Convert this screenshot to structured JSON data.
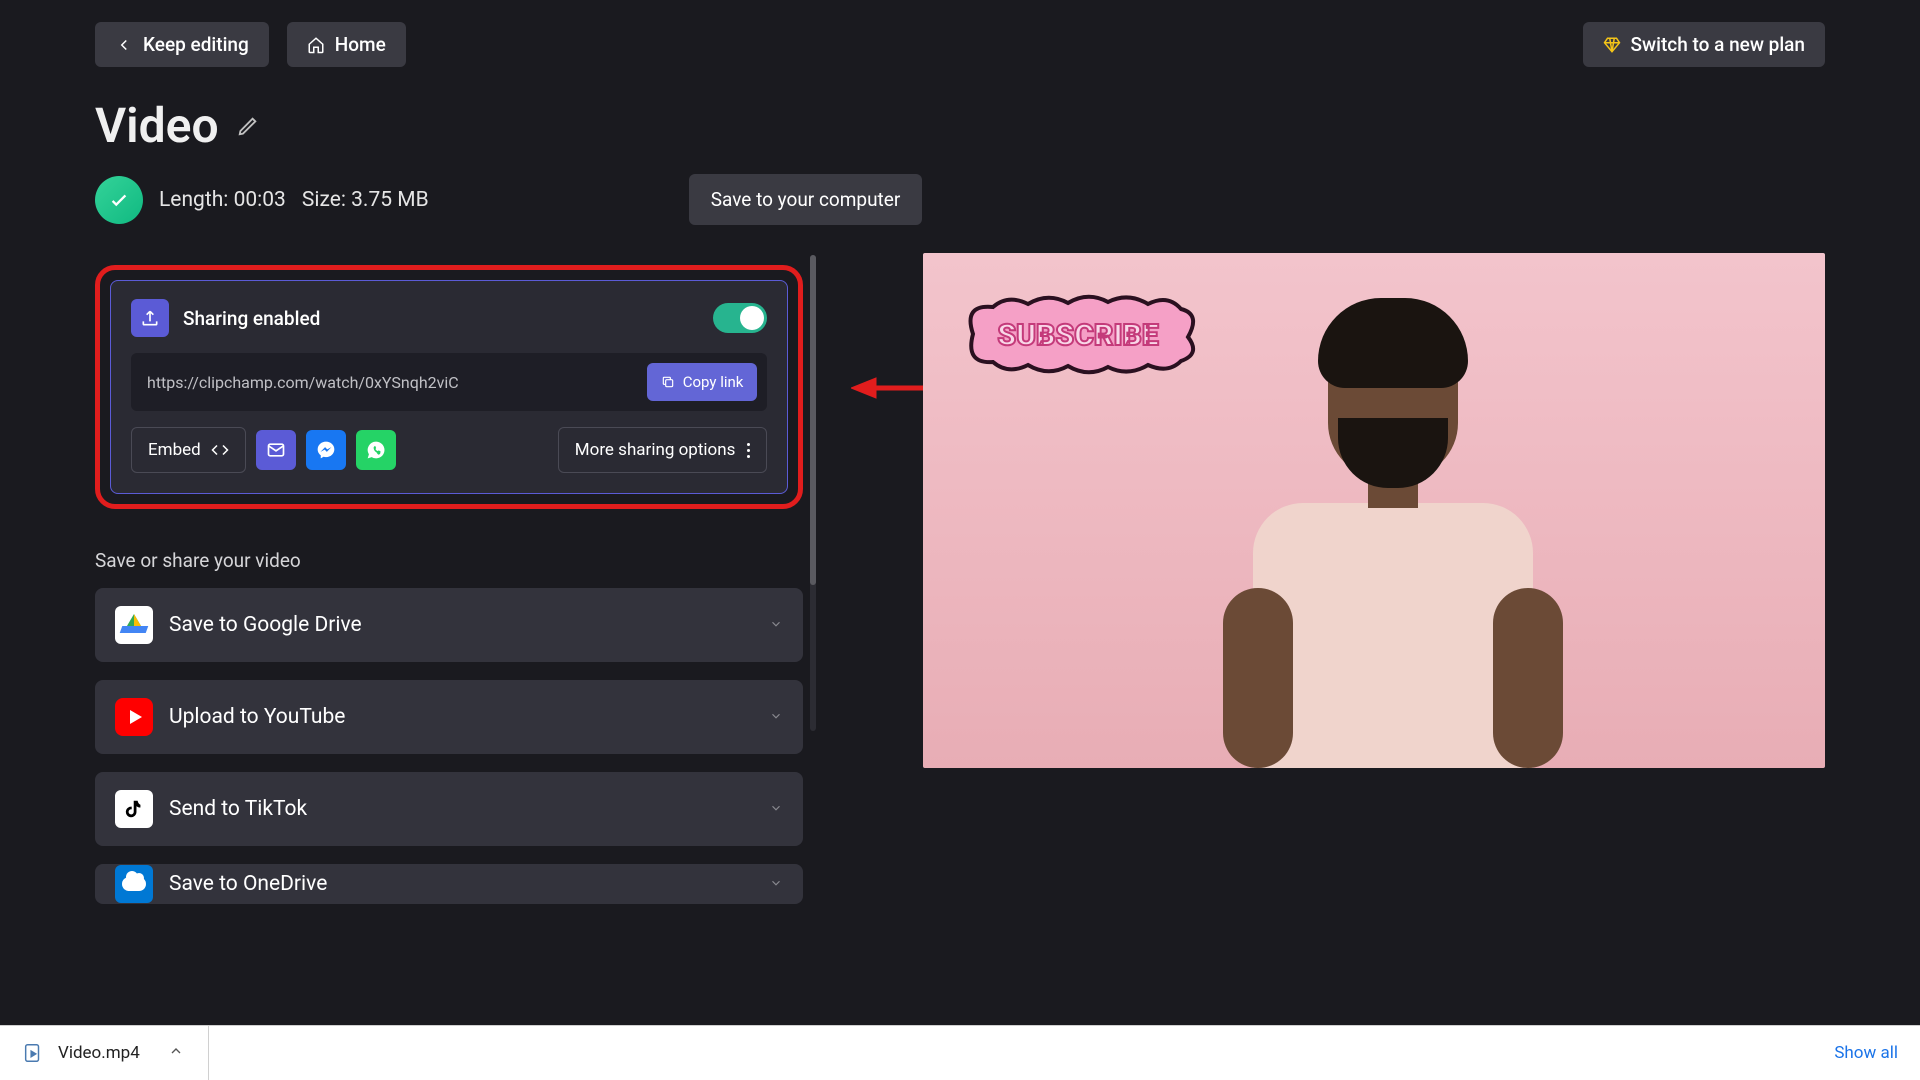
{
  "topbar": {
    "keep_editing": "Keep editing",
    "home": "Home",
    "switch_plan": "Switch to a new plan"
  },
  "title": "Video",
  "meta": {
    "length_label": "Length: 00:03",
    "size_label": "Size: 3.75 MB",
    "save_button": "Save to your computer"
  },
  "sharing": {
    "title": "Sharing enabled",
    "url": "https://clipchamp.com/watch/0xYSnqh2viC",
    "copy_label": "Copy link",
    "embed_label": "Embed",
    "more_label": "More sharing options"
  },
  "section_label": "Save or share your video",
  "destinations": [
    {
      "label": "Save to Google Drive",
      "icon": "google-drive"
    },
    {
      "label": "Upload to YouTube",
      "icon": "youtube"
    },
    {
      "label": "Send to TikTok",
      "icon": "tiktok"
    },
    {
      "label": "Save to OneDrive",
      "icon": "onedrive"
    }
  ],
  "preview": {
    "badge_text": "SUBSCRIBE"
  },
  "downloads": {
    "filename": "Video.mp4",
    "show_all": "Show all"
  },
  "colors": {
    "accent": "#5b5bd6",
    "callout": "#e11d1d",
    "toggle_on": "#27b48f"
  }
}
